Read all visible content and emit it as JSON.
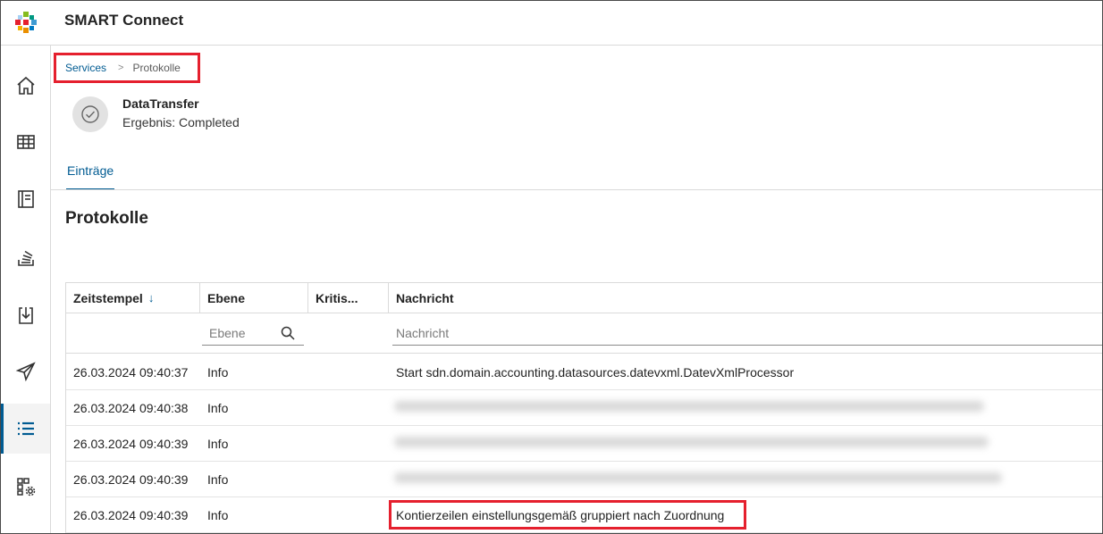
{
  "app": {
    "title": "SMART Connect"
  },
  "colors": {
    "accent": "#005b92",
    "highlight": "#e5202e"
  },
  "sidebar": {
    "items": [
      {
        "icon": "home-icon"
      },
      {
        "icon": "table-icon"
      },
      {
        "icon": "book-icon"
      },
      {
        "icon": "stack-icon"
      },
      {
        "icon": "import-icon"
      },
      {
        "icon": "send-icon"
      },
      {
        "icon": "list-icon",
        "active": true
      },
      {
        "icon": "grid-settings-icon"
      }
    ]
  },
  "breadcrumb": {
    "link": "Services",
    "separator": ">",
    "current": "Protokolle"
  },
  "job": {
    "name": "DataTransfer",
    "result": "Ergebnis: Completed",
    "status_icon": "check-circle-icon"
  },
  "tabs": [
    {
      "label": "Einträge",
      "active": true
    }
  ],
  "section": {
    "title": "Protokolle"
  },
  "table": {
    "columns": [
      {
        "label": "Zeitstempel",
        "sort": "desc"
      },
      {
        "label": "Ebene"
      },
      {
        "label": "Kritis..."
      },
      {
        "label": "Nachricht"
      }
    ],
    "filters": {
      "ebene_placeholder": "Ebene",
      "nachricht_placeholder": "Nachricht"
    },
    "rows": [
      {
        "timestamp": "26.03.2024 09:40:37",
        "level": "Info",
        "message": "Start sdn.domain.accounting.datasources.datevxml.DatevXmlProcessor"
      },
      {
        "timestamp": "26.03.2024 09:40:38",
        "level": "Info",
        "message": ""
      },
      {
        "timestamp": "26.03.2024 09:40:39",
        "level": "Info",
        "message": ""
      },
      {
        "timestamp": "26.03.2024 09:40:39",
        "level": "Info",
        "message": ""
      },
      {
        "timestamp": "26.03.2024 09:40:39",
        "level": "Info",
        "message": "Kontierzeilen einstellungsgemäß gruppiert nach Zuordnung"
      }
    ]
  }
}
